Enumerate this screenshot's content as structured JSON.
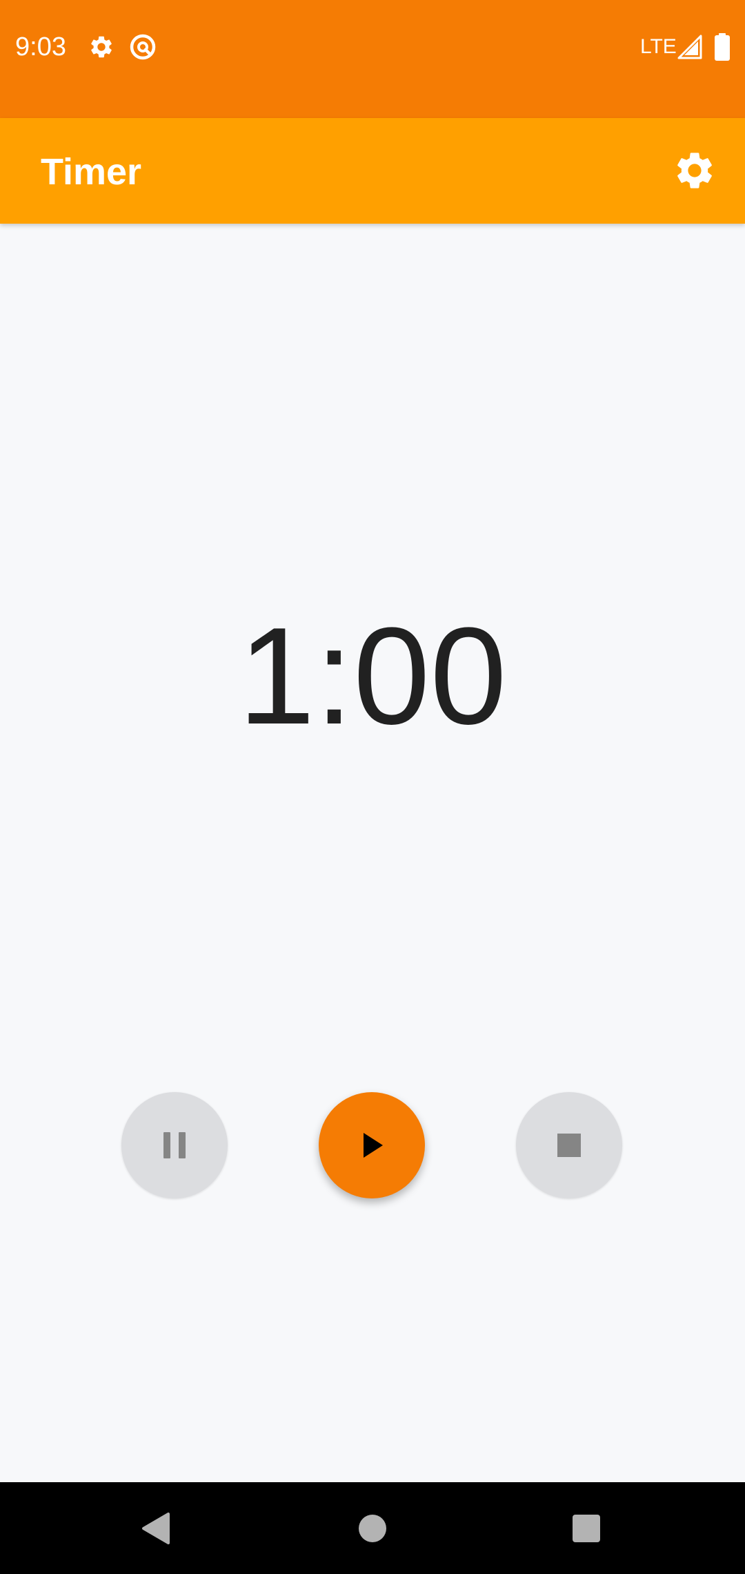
{
  "status_bar": {
    "time": "9:03",
    "network": "LTE",
    "icons": [
      "settings-icon",
      "vpn-at-icon",
      "signal-icon",
      "battery-icon"
    ]
  },
  "app_bar": {
    "title": "Timer",
    "settings_icon": "gear-icon"
  },
  "timer": {
    "display": "1:00"
  },
  "controls": {
    "pause_icon": "pause-icon",
    "play_icon": "play-icon",
    "stop_icon": "stop-icon"
  },
  "nav": {
    "back_icon": "back-triangle-icon",
    "home_icon": "home-circle-icon",
    "recents_icon": "recents-square-icon"
  },
  "colors": {
    "status_bar": "#f57c04",
    "app_bar": "#ffa000",
    "play_button": "#f57c04",
    "secondary_button": "#dcdde0",
    "background": "#f7f8fa"
  }
}
